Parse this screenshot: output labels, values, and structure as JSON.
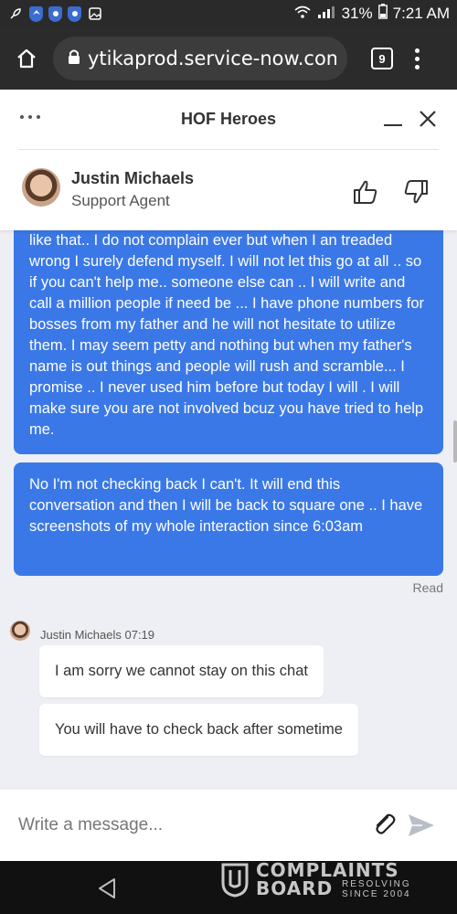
{
  "status_bar": {
    "battery": "31%",
    "time": "7:21 AM"
  },
  "browser": {
    "url": "ytikaprod.service-now.com",
    "tab_count": "9"
  },
  "chat": {
    "title": "HOF Heroes",
    "agent_name": "Justin Michaels",
    "agent_role": "Support Agent"
  },
  "messages": {
    "user_1": "like that.. I do not complain ever but when I an treaded wrong I surely defend myself. I will not let this go at all .. so if you can't help me.. someone else can .. I will write and call a million people if need be ... I have phone numbers for bosses from my father and he will not hesitate to utilize them. I may seem petty and nothing but when my father's name is out things and people will rush and scramble... I promise .. I never used him before but today I will . I will make sure you are not involved bcuz you have tried to help me.",
    "user_2": "No I'm not checking back I can't. It will end this conversation and then I will be back to square one .. I have screenshots of my whole interaction since 6:03am",
    "read_receipt": "Read",
    "agent_meta": "Justin Michaels 07:19",
    "agent_1": "I am sorry we cannot stay on this chat",
    "agent_2": "You will have to check back after sometime"
  },
  "composer": {
    "placeholder": "Write a message..."
  },
  "watermark": {
    "line1": "COMPLAINTS",
    "line2": "BOARD",
    "small1": "RESOLVING",
    "small2": "SINCE 2004"
  }
}
